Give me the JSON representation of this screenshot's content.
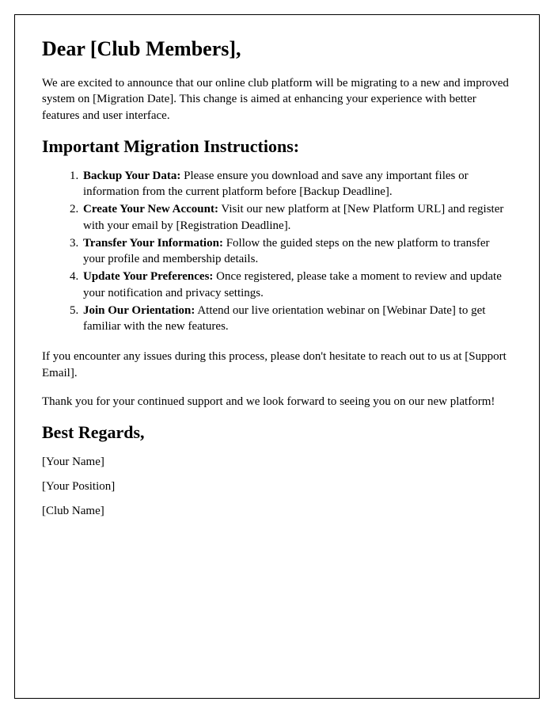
{
  "greeting": "Dear [Club Members],",
  "intro": "We are excited to announce that our online club platform will be migrating to a new and improved system on [Migration Date]. This change is aimed at enhancing your experience with better features and user interface.",
  "instructions_heading": "Important Migration Instructions:",
  "instructions": [
    {
      "label": "Backup Your Data:",
      "text": " Please ensure you download and save any important files or information from the current platform before [Backup Deadline]."
    },
    {
      "label": "Create Your New Account:",
      "text": " Visit our new platform at [New Platform URL] and register with your email by [Registration Deadline]."
    },
    {
      "label": "Transfer Your Information:",
      "text": " Follow the guided steps on the new platform to transfer your profile and membership details."
    },
    {
      "label": "Update Your Preferences:",
      "text": " Once registered, please take a moment to review and update your notification and privacy settings."
    },
    {
      "label": "Join Our Orientation:",
      "text": " Attend our live orientation webinar on [Webinar Date] to get familiar with the new features."
    }
  ],
  "support_text": "If you encounter any issues during this process, please don't hesitate to reach out to us at [Support Email].",
  "thanks_text": "Thank you for your continued support and we look forward to seeing you on our new platform!",
  "closing": "Best Regards,",
  "signature": {
    "name": "[Your Name]",
    "position": "[Your Position]",
    "club": "[Club Name]"
  }
}
